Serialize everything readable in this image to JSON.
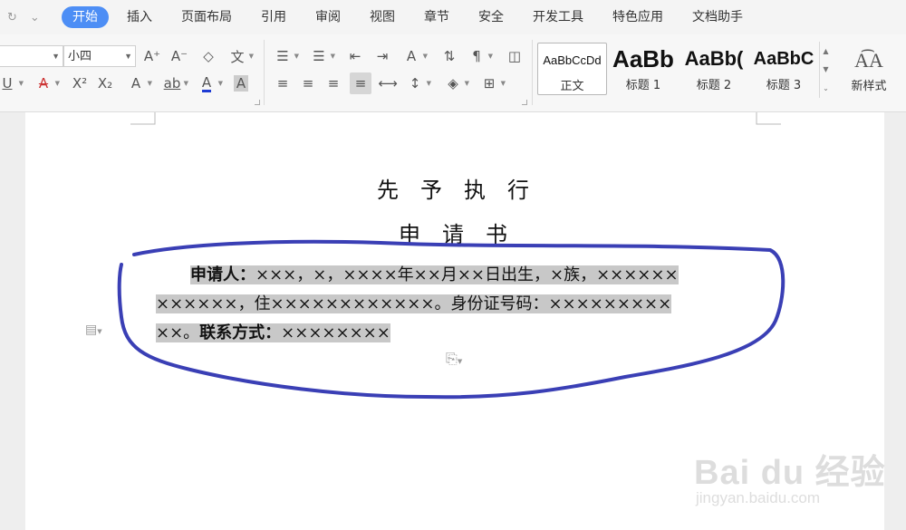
{
  "menubar": {
    "tabs": [
      "开始",
      "插入",
      "页面布局",
      "引用",
      "审阅",
      "视图",
      "章节",
      "安全",
      "开发工具",
      "特色应用",
      "文档助手"
    ],
    "active_tab": "开始"
  },
  "ribbon": {
    "font_name": "",
    "font_size": "小四",
    "styles": [
      {
        "preview": "AaBbCcDd",
        "name": "正文"
      },
      {
        "preview": "AaBb",
        "name": "标题 1"
      },
      {
        "preview": "AaBb(",
        "name": "标题 2"
      },
      {
        "preview": "AaBbC",
        "name": "标题 3"
      }
    ],
    "new_style_label": "新样式",
    "accent_color": "#4d8ef5"
  },
  "document": {
    "title_line1": "先　予　执　行",
    "title_line2": "申　请　书",
    "para_line1_label": "申请人：",
    "para_line1_text": "×××，×，××××年××月××日出生，×族，××××××",
    "para_line2_text": "××××××，住××××××××××××。身份证号码：×××××××××",
    "para_line3_text": "××。",
    "para_line3_label": "联系方式：",
    "para_line3_value": "××××××××",
    "annotation_color": "#3a3fb5",
    "highlight_color": "#c8c8c8"
  },
  "watermark": {
    "logo": "Bai du 经验",
    "url": "jingyan.baidu.com"
  }
}
